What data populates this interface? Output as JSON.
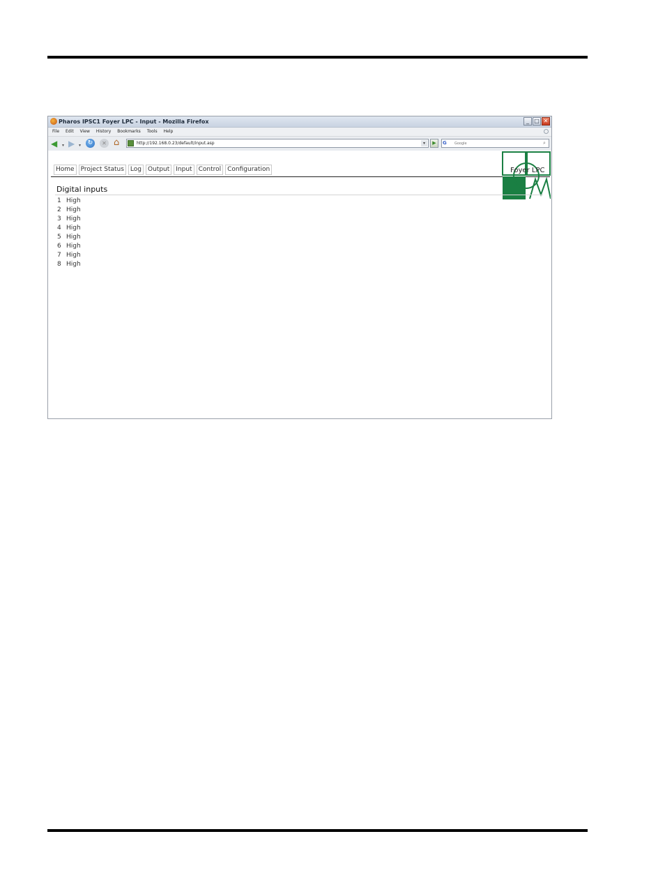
{
  "window": {
    "title": "Pharos IPSC1 Foyer LPC - Input - Mozilla Firefox",
    "buttons": {
      "minimize": "_",
      "maximize": "□",
      "close": "✕"
    }
  },
  "menu": [
    "File",
    "Edit",
    "View",
    "History",
    "Bookmarks",
    "Tools",
    "Help"
  ],
  "nav": {
    "url": "http://192.168.0.23/default/input.asp",
    "search_placeholder": "Google",
    "search_engine": "G"
  },
  "page": {
    "tabs": [
      "Home",
      "Project Status",
      "Log",
      "Output",
      "Input",
      "Control",
      "Configuration"
    ],
    "logo_text": "Foyer LPC",
    "section_title": "Digital inputs",
    "inputs": [
      {
        "num": "1",
        "state": "High"
      },
      {
        "num": "2",
        "state": "High"
      },
      {
        "num": "3",
        "state": "High"
      },
      {
        "num": "4",
        "state": "High"
      },
      {
        "num": "5",
        "state": "High"
      },
      {
        "num": "6",
        "state": "High"
      },
      {
        "num": "7",
        "state": "High"
      },
      {
        "num": "8",
        "state": "High"
      }
    ]
  },
  "colors": {
    "brand_green": "#1a7f43",
    "rule": "#000000"
  }
}
